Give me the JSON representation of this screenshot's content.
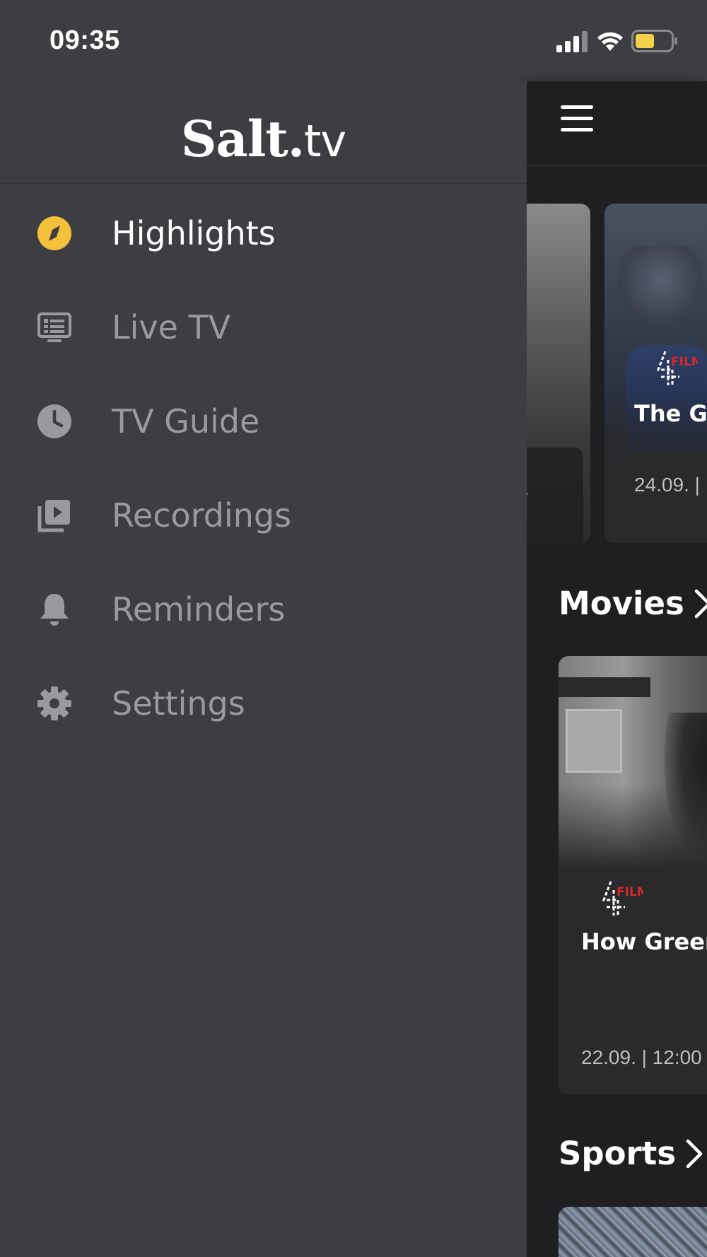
{
  "status_bar": {
    "time": "09:35",
    "signal_icon": "cellular-signal-icon",
    "wifi_icon": "wifi-icon",
    "battery_icon": "battery-icon",
    "battery_color": "#f5d04a"
  },
  "drawer": {
    "logo": {
      "bold": "Salt.",
      "light": "tv"
    },
    "nav_items": [
      {
        "label": "Highlights",
        "icon": "compass-icon",
        "active": true
      },
      {
        "label": "Live TV",
        "icon": "tv-icon",
        "active": false
      },
      {
        "label": "TV Guide",
        "icon": "clock-icon",
        "active": false
      },
      {
        "label": "Recordings",
        "icon": "recordings-icon",
        "active": false
      },
      {
        "label": "Reminders",
        "icon": "bell-icon",
        "active": false
      },
      {
        "label": "Settings",
        "icon": "gear-icon",
        "active": false
      }
    ],
    "accent_color": "#f5c13b"
  },
  "main": {
    "menu_icon": "hamburger-menu-icon",
    "featured": {
      "title": "The Gi",
      "meta": "24.09. |",
      "channel": "FILM"
    },
    "movies_section": {
      "title": "Movies",
      "card": {
        "title": "How Green",
        "meta": "22.09. | 12:00",
        "channel": "FILM"
      }
    },
    "sports_section": {
      "title": "Sports"
    }
  }
}
